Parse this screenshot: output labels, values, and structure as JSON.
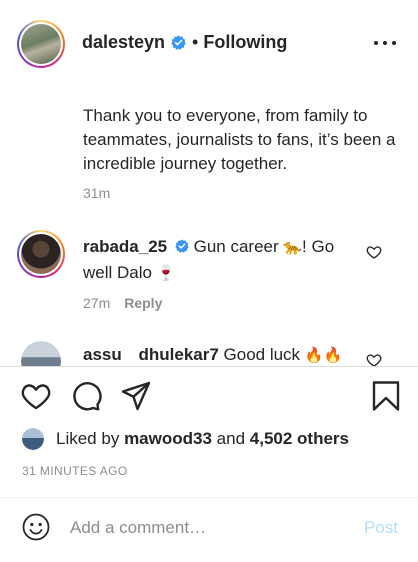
{
  "post": {
    "author": "dalesteyn",
    "follow_state": "Following",
    "separator": "•",
    "caption": "Thank you to everyone, from family to teammates, journalists to fans, it’s been a incredible journey together.",
    "caption_age": "31m"
  },
  "comments": [
    {
      "username": "rabada_25",
      "text_before_emoji": " Gun career ",
      "emoji_1": "🐆",
      "text_after_emoji": "! Go well Dalo ",
      "emoji_2": "🍷",
      "age": "27m",
      "reply_label": "Reply"
    },
    {
      "username": "assu",
      "mention": "dhulekar7",
      "text": " Good luck ",
      "emoji": "🔥🔥"
    }
  ],
  "likes": {
    "prefix": "Liked by",
    "user": "mawood33",
    "conjunction": "and",
    "others": "4,502 others"
  },
  "timestamp": "31 MINUTES AGO",
  "comment_box": {
    "placeholder": "Add a comment…",
    "post_label": "Post"
  },
  "colors": {
    "verified": "#3897f0",
    "post_disabled": "#b2dffc",
    "meta_gray": "#8e8e8e"
  }
}
